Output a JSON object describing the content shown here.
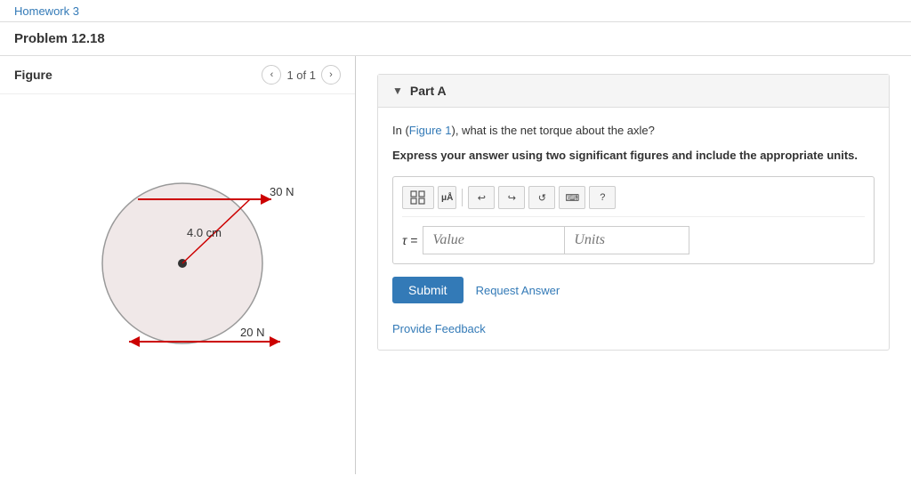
{
  "nav": {
    "breadcrumb_text": "Homework 3"
  },
  "problem": {
    "title": "Problem 12.18"
  },
  "figure": {
    "title": "Figure",
    "nav_label": "1 of 1",
    "force1_label": "30 N",
    "force2_label": "20 N",
    "radius_label": "4.0 cm"
  },
  "part_a": {
    "header": "Part A",
    "question": "In (Figure 1), what is the net torque about the axle?",
    "figure_link": "Figure 1",
    "instruction": "Express your answer using two significant figures and include the appropriate units.",
    "tau_label": "τ =",
    "value_placeholder": "Value",
    "units_placeholder": "Units",
    "submit_label": "Submit",
    "request_answer_label": "Request Answer"
  },
  "toolbar": {
    "btn1_label": "⊞",
    "btn2_label": "μÅ",
    "undo_label": "↩",
    "redo_label": "↪",
    "reset_label": "↺",
    "keyboard_label": "⌨",
    "help_label": "?"
  },
  "footer": {
    "feedback_label": "Provide Feedback"
  }
}
